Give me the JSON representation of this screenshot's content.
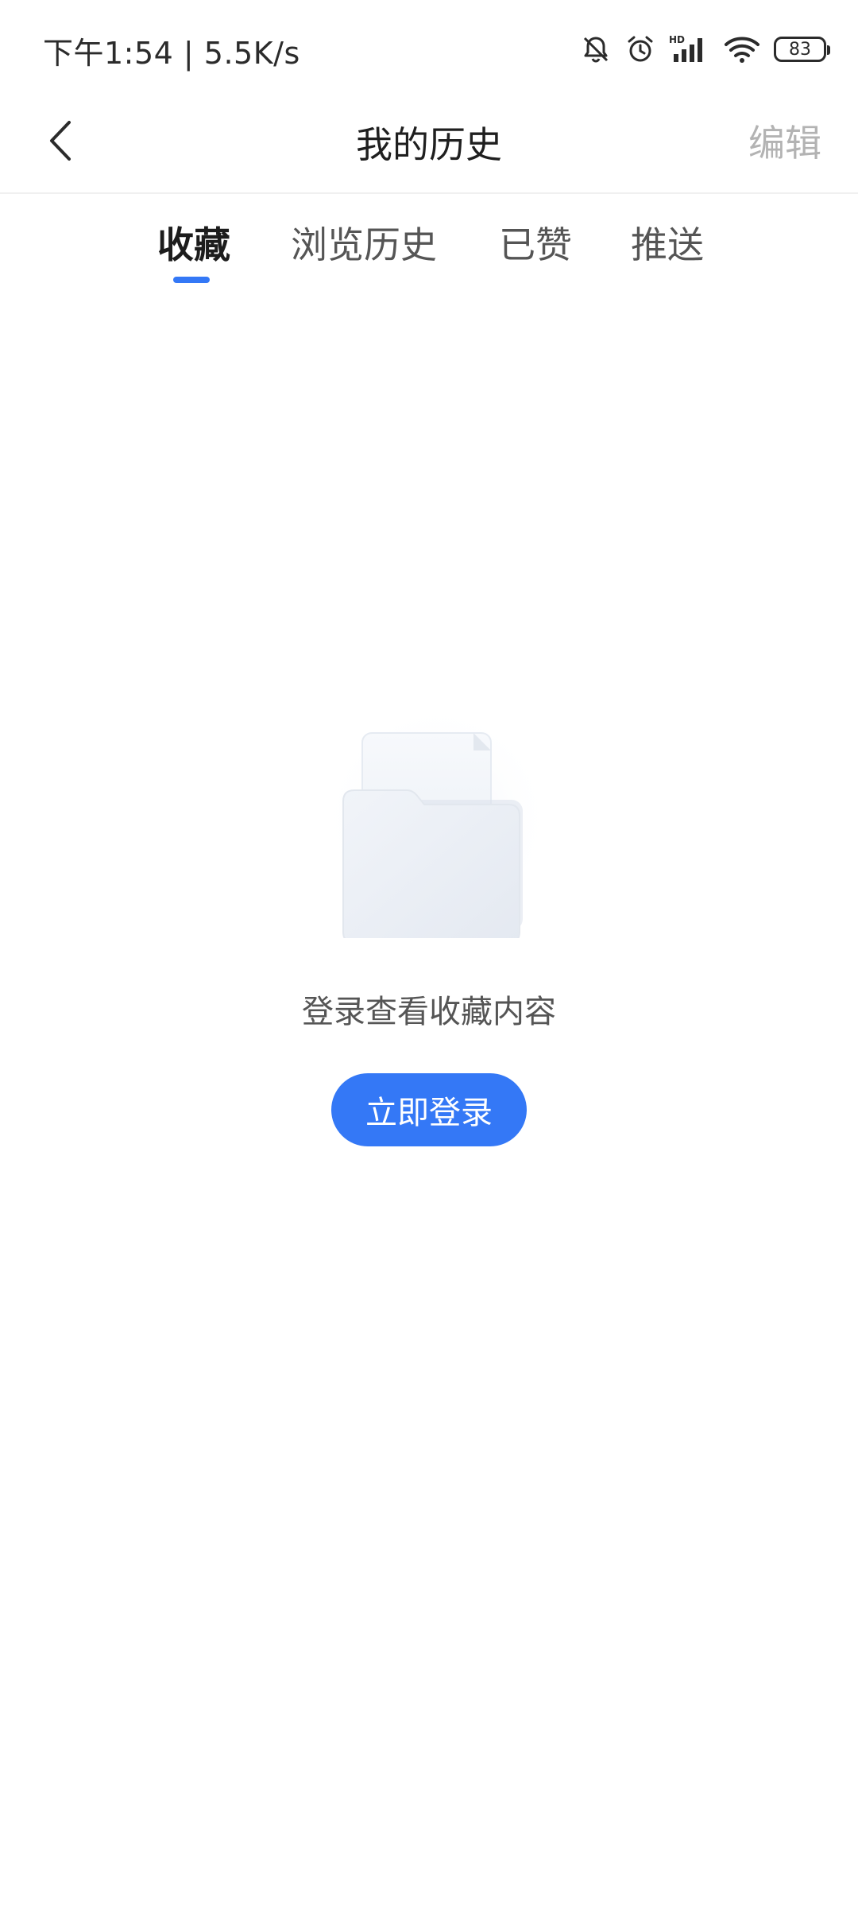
{
  "status_bar": {
    "time_speed": "下午1:54 | 5.5K/s",
    "battery": "83",
    "icons": [
      "bell-muted-icon",
      "alarm-icon",
      "signal-hd-icon",
      "wifi-icon",
      "battery-icon"
    ]
  },
  "header": {
    "title": "我的历史",
    "edit_label": "编辑",
    "back_icon": "chevron-left-icon"
  },
  "tabs": [
    {
      "label": "收藏",
      "active": true
    },
    {
      "label": "浏览历史",
      "active": false
    },
    {
      "label": "已赞",
      "active": false
    },
    {
      "label": "推送",
      "active": false
    }
  ],
  "empty_state": {
    "icon": "folder-icon",
    "message": "登录查看收藏内容",
    "button_label": "立即登录"
  },
  "colors": {
    "accent": "#3478f6",
    "muted_text": "#b3b3b3"
  }
}
